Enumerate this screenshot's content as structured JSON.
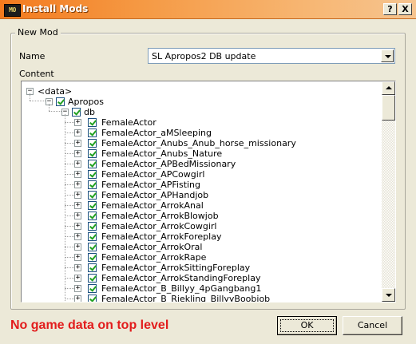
{
  "window": {
    "title": "Install Mods",
    "app_icon_text": "MO",
    "help_label": "?",
    "close_label": "X"
  },
  "group": {
    "legend": "New Mod",
    "name_label": "Name",
    "content_label": "Content"
  },
  "name_combo": {
    "value": "SL Apropos2 DB update"
  },
  "tree": {
    "root": "<data>",
    "level1": "Apropos",
    "level2": "db",
    "items": [
      "FemaleActor",
      "FemaleActor_aMSleeping",
      "FemaleActor_Anubs_Anub_horse_missionary",
      "FemaleActor_Anubs_Nature",
      "FemaleActor_APBedMissionary",
      "FemaleActor_APCowgirl",
      "FemaleActor_APFisting",
      "FemaleActor_APHandjob",
      "FemaleActor_ArrokAnal",
      "FemaleActor_ArrokBlowjob",
      "FemaleActor_ArrokCowgirl",
      "FemaleActor_ArrokForeplay",
      "FemaleActor_ArrokOral",
      "FemaleActor_ArrokRape",
      "FemaleActor_ArrokSittingForeplay",
      "FemaleActor_ArrokStandingForeplay",
      "FemaleActor_B_Billyy_4pGangbang1",
      "FemaleActor_B_Riekling_BillyyBoobjob"
    ]
  },
  "status": {
    "message": "No game data on top level",
    "color": "#e21c1c"
  },
  "buttons": {
    "ok": "OK",
    "cancel": "Cancel"
  }
}
